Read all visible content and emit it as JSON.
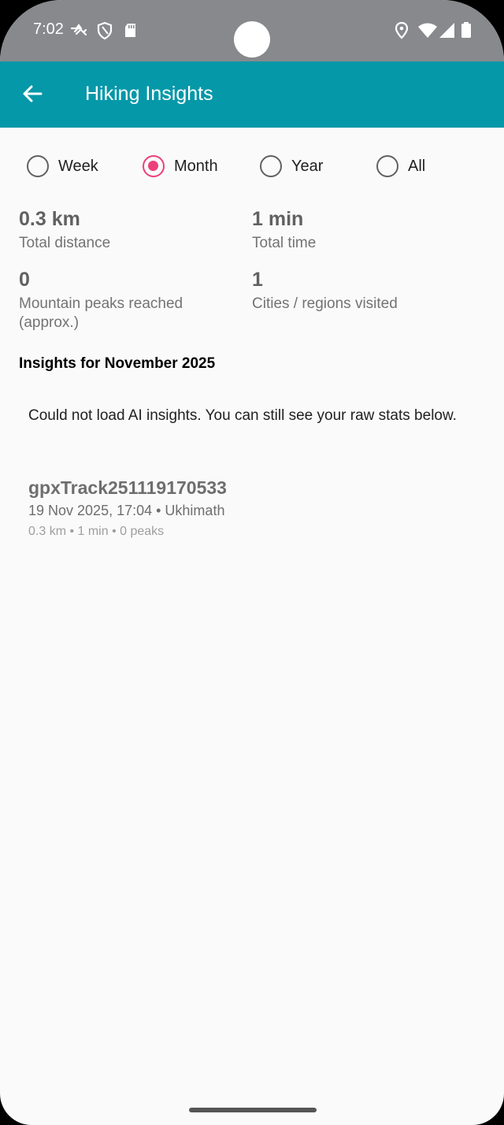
{
  "status_bar": {
    "time": "7:02",
    "icons": [
      "weather-icon",
      "shield-icon",
      "sd-card-icon",
      "location-icon",
      "wifi-icon",
      "signal-icon",
      "battery-icon"
    ]
  },
  "app_bar": {
    "title": "Hiking Insights",
    "background_color": "#0598a8"
  },
  "period_filter": {
    "selected": "Month",
    "accent_color": "#ec407a",
    "options": [
      {
        "label": "Week",
        "checked": false
      },
      {
        "label": "Month",
        "checked": true
      },
      {
        "label": "Year",
        "checked": false
      },
      {
        "label": "All",
        "checked": false
      }
    ]
  },
  "stats": {
    "distance": {
      "value": "0.3 km",
      "label": "Total distance"
    },
    "time": {
      "value": "1 min",
      "label": "Total time"
    },
    "peaks": {
      "value": "0",
      "label": "Mountain peaks reached (approx.)"
    },
    "regions": {
      "value": "1",
      "label": "Cities / regions visited"
    }
  },
  "insights": {
    "title": "Insights for November 2025",
    "message": "Could not load AI insights. You can still see your raw stats below."
  },
  "tracks": [
    {
      "name": "gpxTrack251119170533",
      "meta": "19 Nov 2025, 17:04 • Ukhimath",
      "stats": "0.3 km • 1 min • 0 peaks"
    }
  ]
}
